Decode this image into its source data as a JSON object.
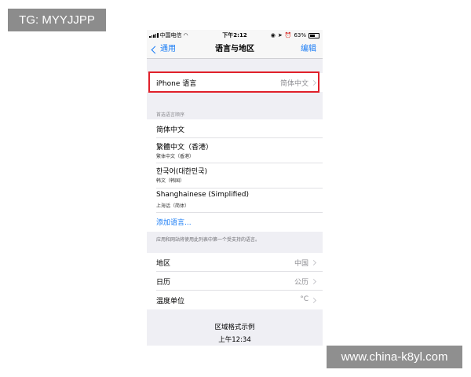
{
  "overlay": {
    "tg_badge": "TG: MYYJJPP",
    "site_badge": "www.china-k8yl.com"
  },
  "status_bar": {
    "carrier": "中国电信",
    "time": "下午2:12",
    "battery": "63%",
    "battery_level": 0.63
  },
  "nav": {
    "back_label": "通用",
    "title": "语言与地区",
    "edit_label": "编辑"
  },
  "iphone_language": {
    "label": "iPhone 语言",
    "value": "简体中文"
  },
  "preferred_order": {
    "header": "首选语言顺序",
    "languages": [
      {
        "name": "简体中文",
        "subtitle": ""
      },
      {
        "name": "繁體中文（香港）",
        "subtitle": "繁体中文（香港）"
      },
      {
        "name": "한국어(대한민국)",
        "subtitle": "韩文（韩国）"
      },
      {
        "name": "Shanghainese (Simplified)",
        "subtitle": "上海话（简体）"
      }
    ],
    "add_language": "添加语言...",
    "footer": "应用和网站将使用此列表中第一个受支持的语言。"
  },
  "region_settings": [
    {
      "label": "地区",
      "value": "中国"
    },
    {
      "label": "日历",
      "value": "公历"
    },
    {
      "label": "温度单位",
      "value": "°C"
    }
  ],
  "format_example": {
    "title": "区域格式示例",
    "time": "上午12:34"
  }
}
